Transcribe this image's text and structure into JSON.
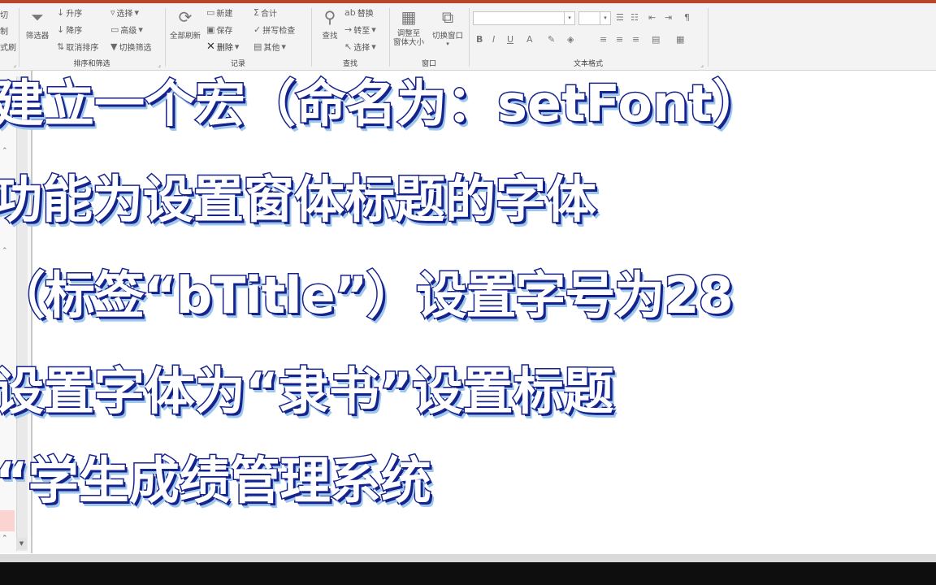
{
  "ribbon": {
    "clipboard": {
      "cut_label": "切",
      "copy_label": "制",
      "painter_label": "式刷"
    },
    "sort_filter": {
      "filter_label": "筛选器",
      "ascending_label": "升序",
      "descending_label": "降序",
      "remove_sort_label": "取消排序",
      "selection_label": "选择",
      "advanced_label": "高级",
      "toggle_filter_label": "切换筛选",
      "group_label": "排序和筛选"
    },
    "records": {
      "refresh_all_label": "全部刷新",
      "new_label": "新建",
      "save_label": "保存",
      "delete_label": "删除",
      "totals_label": "合计",
      "spelling_label": "拼写检查",
      "more_label": "其他",
      "group_label": "记录"
    },
    "find": {
      "find_label": "查找",
      "replace_label": "替换",
      "goto_label": "转至",
      "select_label": "选择",
      "group_label": "查找"
    },
    "window": {
      "size_to_fit_label": "调整至\n窗体大小",
      "switch_windows_label": "切换窗口",
      "group_label": "窗口"
    },
    "text_format": {
      "font_name_value": "",
      "font_size_value": "",
      "bold_label": "B",
      "italic_label": "I",
      "underline_label": "U",
      "font_color_label": "A",
      "group_label": "文本格式"
    }
  },
  "overlay": {
    "lines": [
      "建立一个宏（命名为：setFont）",
      "功能为设置窗体标题的字体",
      "（标签“bTitle”）设置字号为28",
      "设置字体为“隶书”设置标题",
      "“学生成绩管理系统"
    ]
  },
  "colors": {
    "overlay_fill": "#ffffff",
    "overlay_outline": "#17238c",
    "overlay_shadow": "#9ec7ee",
    "access_accent": "#b7472a"
  }
}
